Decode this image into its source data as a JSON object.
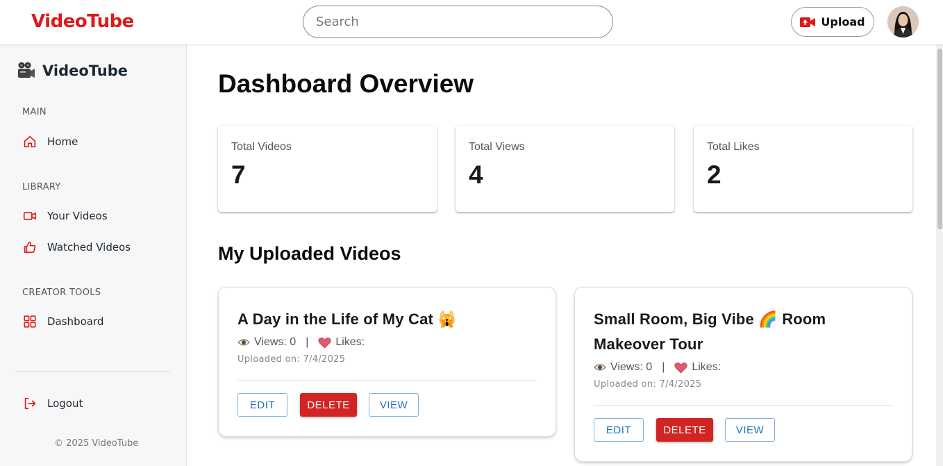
{
  "header": {
    "brand": "VideoTube",
    "search_placeholder": "Search",
    "upload_label": "Upload"
  },
  "sidebar": {
    "brand": "VideoTube",
    "sections": {
      "main": "MAIN",
      "library": "LIBRARY",
      "creator_tools": "CREATOR TOOLS"
    },
    "items": {
      "home": "Home",
      "your_videos": "Your Videos",
      "watched_videos": "Watched Videos",
      "dashboard": "Dashboard",
      "logout": "Logout"
    },
    "copyright": "© 2025 VideoTube"
  },
  "main": {
    "title": "Dashboard Overview",
    "stats": [
      {
        "label": "Total Videos",
        "value": "7"
      },
      {
        "label": "Total Views",
        "value": "4"
      },
      {
        "label": "Total Likes",
        "value": "2"
      }
    ],
    "section_title": "My Uploaded Videos",
    "videos": [
      {
        "title": "A Day in the Life of My Cat 🙀",
        "views": "Views: 0",
        "separator": "|",
        "likes": "Likes:",
        "uploaded": "Uploaded on: 7/4/2025",
        "edit": "EDIT",
        "delete": "DELETE",
        "view": "VIEW"
      },
      {
        "title": "Small Room, Big Vibe 🌈 Room Makeover Tour",
        "views": "Views: 0",
        "separator": "|",
        "likes": "Likes:",
        "uploaded": "Uploaded on: 7/4/2025",
        "edit": "EDIT",
        "delete": "DELETE",
        "view": "VIEW"
      }
    ]
  },
  "colors": {
    "brand_red": "#e01919",
    "delete_red": "#d32424",
    "link_blue": "#1e73be"
  },
  "icons": [
    "camera-icon",
    "home-icon",
    "video-camera-icon",
    "thumbs-up-icon",
    "dashboard-grid-icon",
    "logout-icon",
    "eye-icon",
    "heart-icon",
    "upload-video-icon"
  ]
}
